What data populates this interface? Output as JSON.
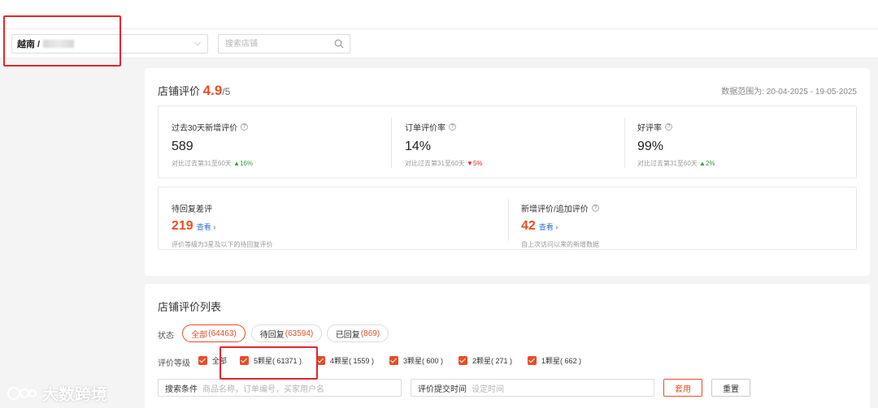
{
  "header": {
    "region_label": "越南 /",
    "search_placeholder": "搜索店铺"
  },
  "overview": {
    "title": "店铺评价",
    "score": "4.9",
    "score_total": "/5",
    "date_range": "数据范围为: 20-04-2025 - 19-05-2025",
    "stats": [
      {
        "label": "过去30天新增评价",
        "value": "589",
        "compare": "对比过去第31至60天",
        "delta": "▲16%",
        "trend": "up"
      },
      {
        "label": "订单评价率",
        "value": "14%",
        "compare": "对比过去第31至60天",
        "delta": "▼5%",
        "trend": "down"
      },
      {
        "label": "好评率",
        "value": "99%",
        "compare": "对比过去第31至60天",
        "delta": "▲2%",
        "trend": "up"
      }
    ],
    "pending": {
      "label": "待回复差评",
      "value": "219",
      "link": "查看 ›",
      "sub": "评价等级为3星及以下的待回复评价"
    },
    "new_reviews": {
      "label": "新增评价/追加评价",
      "value": "42",
      "link": "查看 ›",
      "sub": "自上次访问以来的新增数据"
    }
  },
  "list": {
    "title": "店铺评价列表",
    "status_label": "状态",
    "status_tabs": [
      {
        "label": "全部 ",
        "count": "(64463)"
      },
      {
        "label": "待回复 ",
        "count": "(63594)"
      },
      {
        "label": "已回复 ",
        "count": "(869)"
      }
    ],
    "rating_label": "评价等级",
    "ratings": [
      "全部",
      "5颗星( 61371 )",
      "4颗星( 1559 )",
      "3颗星( 600 )",
      "2颗星( 271 )",
      "1颗星( 662 )"
    ],
    "search_label": "搜索条件",
    "search_placeholder": "商品名称，订单编号，买家用户名",
    "time_label": "评价提交时间",
    "time_placeholder": "设定时间",
    "apply_button": "套用",
    "reset_button": "重置"
  },
  "watermark": "大数跨境",
  "colors": {
    "accent": "#e84e25",
    "highlight": "#e3262b",
    "link": "#2c6fd9",
    "up": "#2ba245"
  }
}
